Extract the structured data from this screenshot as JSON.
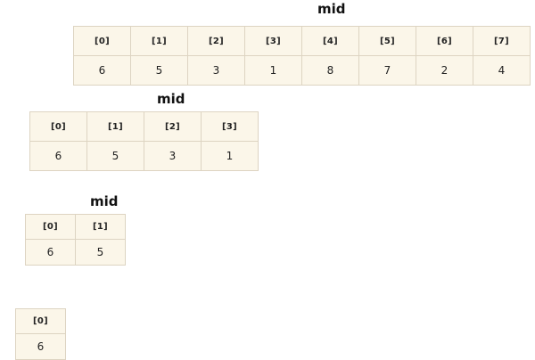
{
  "levels": [
    {
      "mid_label": "mid",
      "indices": [
        "[0]",
        "[1]",
        "[2]",
        "[3]",
        "[4]",
        "[5]",
        "[6]",
        "[7]"
      ],
      "values": [
        "6",
        "5",
        "3",
        "1",
        "8",
        "7",
        "2",
        "4"
      ]
    },
    {
      "mid_label": "mid",
      "indices": [
        "[0]",
        "[1]",
        "[2]",
        "[3]"
      ],
      "values": [
        "6",
        "5",
        "3",
        "1"
      ]
    },
    {
      "mid_label": "mid",
      "indices": [
        "[0]",
        "[1]"
      ],
      "values": [
        "6",
        "5"
      ]
    },
    {
      "indices": [
        "[0]"
      ],
      "values": [
        "6"
      ]
    }
  ],
  "colors": {
    "cell_fill": "#fbf6e9",
    "cell_border": "#ddd4c2",
    "text": "#222222"
  }
}
